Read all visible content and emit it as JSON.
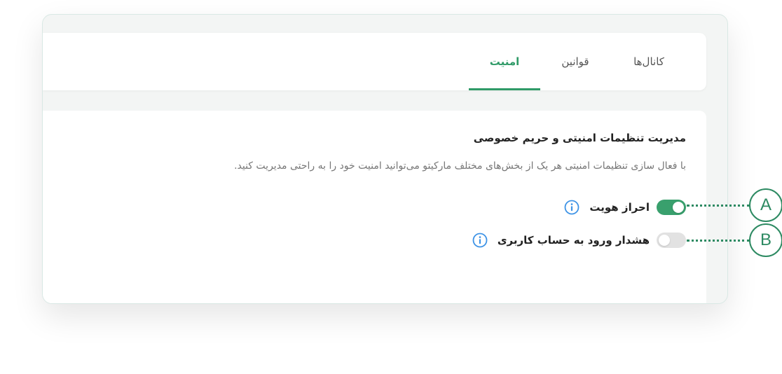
{
  "tabs": [
    {
      "label": "کانال‌ها",
      "active": false
    },
    {
      "label": "قوانین",
      "active": false
    },
    {
      "label": "امنیت",
      "active": true
    }
  ],
  "section": {
    "title": "مدیریت تنظیمات امنیتی و حریم خصوصی",
    "description": "با فعال سازی تنظیمات امنیتی هر یک از بخش‌های مختلف مارکیتو می‌توانید امنیت خود را به راحتی مدیریت کنید."
  },
  "settings": [
    {
      "label": "احراز هویت",
      "enabled": true,
      "icon": "info-icon"
    },
    {
      "label": "هشدار ورود به حساب کاربری",
      "enabled": false,
      "icon": "info-icon"
    }
  ],
  "callouts": [
    "A",
    "B"
  ],
  "colors": {
    "accent": "#2f9a67",
    "toggle_on": "#39a06d",
    "toggle_off": "#e2e2e2",
    "info": "#3d93e6",
    "callout": "#2d8a62"
  }
}
